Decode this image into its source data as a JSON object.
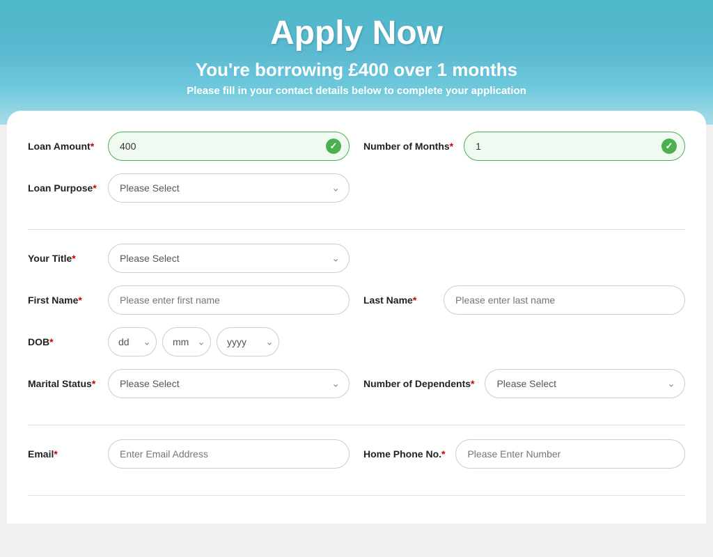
{
  "header": {
    "title": "Apply Now",
    "subtitle": "You're borrowing £400 over 1 months",
    "description": "Please fill in your contact details below to complete your application"
  },
  "form": {
    "loan_amount_label": "Loan Amount",
    "loan_amount_value": "400",
    "number_of_months_label": "Number of Months",
    "number_of_months_value": "1",
    "loan_purpose_label": "Loan Purpose",
    "loan_purpose_placeholder": "Please Select",
    "your_title_label": "Your Title",
    "your_title_placeholder": "Please Select",
    "first_name_label": "First Name",
    "first_name_placeholder": "Please enter first name",
    "last_name_label": "Last Name",
    "last_name_placeholder": "Please enter last name",
    "dob_label": "DOB",
    "dob_dd": "dd",
    "dob_mm": "mm",
    "dob_yyyy": "yyyy",
    "marital_status_label": "Marital Status",
    "marital_status_placeholder": "Please Select",
    "number_of_dependents_label": "Number of Dependents",
    "number_of_dependents_placeholder": "Please Select",
    "email_label": "Email",
    "email_placeholder": "Enter Email Address",
    "home_phone_label": "Home Phone No.",
    "home_phone_placeholder": "Please Enter Number",
    "required_marker": "*"
  },
  "colors": {
    "header_bg_start": "#4db8c8",
    "header_bg_end": "#a8dce8",
    "required": "#cc0000",
    "valid_border": "#4caf50",
    "valid_bg": "#f0faf0",
    "check_bg": "#4caf50"
  }
}
